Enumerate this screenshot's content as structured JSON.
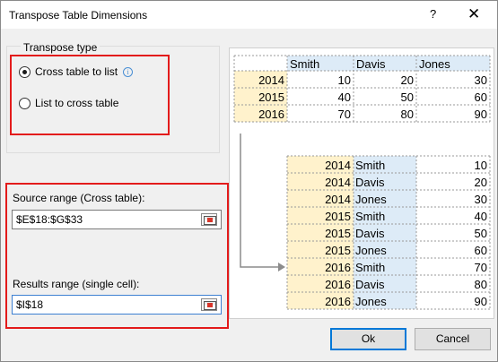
{
  "window": {
    "title": "Transpose Table Dimensions",
    "help_label": "?",
    "close_label": "✕"
  },
  "transpose_type": {
    "group_label": "Transpose type",
    "options": [
      {
        "label": "Cross table to list",
        "selected": true,
        "info_icon": "info-icon"
      },
      {
        "label": "List to cross table",
        "selected": false
      }
    ]
  },
  "source_range": {
    "label": "Source range (Cross table):",
    "value": "$E$18:$G$33"
  },
  "results_range": {
    "label": "Results range (single cell):",
    "value": "$I$18"
  },
  "preview": {
    "cross_table": {
      "headers": [
        "Smith",
        "Davis",
        "Jones"
      ],
      "rows": [
        {
          "year": "2014",
          "values": [
            "10",
            "20",
            "30"
          ]
        },
        {
          "year": "2015",
          "values": [
            "40",
            "50",
            "60"
          ]
        },
        {
          "year": "2016",
          "values": [
            "70",
            "80",
            "90"
          ]
        }
      ]
    },
    "list_table": [
      {
        "year": "2014",
        "name": "Smith",
        "value": "10"
      },
      {
        "year": "2014",
        "name": "Davis",
        "value": "20"
      },
      {
        "year": "2014",
        "name": "Jones",
        "value": "30"
      },
      {
        "year": "2015",
        "name": "Smith",
        "value": "40"
      },
      {
        "year": "2015",
        "name": "Davis",
        "value": "50"
      },
      {
        "year": "2015",
        "name": "Jones",
        "value": "60"
      },
      {
        "year": "2016",
        "name": "Smith",
        "value": "70"
      },
      {
        "year": "2016",
        "name": "Davis",
        "value": "80"
      },
      {
        "year": "2016",
        "name": "Jones",
        "value": "90"
      }
    ],
    "colors": {
      "header_blue": "#ddebf7",
      "year_yellow": "#fff2cc",
      "arrow": "#8c8c8c"
    }
  },
  "buttons": {
    "ok": "Ok",
    "cancel": "Cancel"
  }
}
